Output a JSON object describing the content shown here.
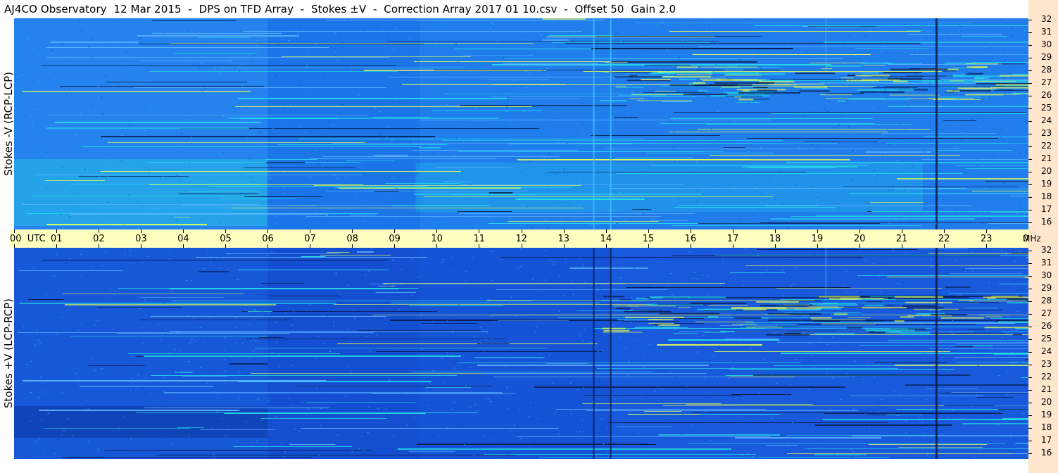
{
  "title": "AJ4CO Observatory  12 Mar 2015  -  DPS on TFD Array  -  Stokes ±V  -  Correction Array 2017 01 10.csv  -  Offset 50  Gain 2.0",
  "panels": {
    "top_label": "Stokes -V (RCP-LCP)",
    "bottom_label": "Stokes +V (LCP-RCP)"
  },
  "time_axis": {
    "labels": [
      "00  UTC",
      "01",
      "02",
      "03",
      "04",
      "05",
      "06",
      "07",
      "08",
      "09",
      "10",
      "11",
      "12",
      "13",
      "14",
      "15",
      "16",
      "17",
      "18",
      "19",
      "20",
      "21",
      "22",
      "23",
      "00"
    ],
    "background": "#ffffc0"
  },
  "freq_axis": {
    "unit": "MHz",
    "labels": [
      "32",
      "31",
      "30",
      "29",
      "28",
      "27",
      "26",
      "25",
      "24",
      "23",
      "22",
      "21",
      "20",
      "19",
      "18",
      "17",
      "16"
    ],
    "background": "#ffe6cc"
  },
  "colors": {
    "top_base": "#1e7bea",
    "bottom_base": "#1552d6",
    "hot": "#e8ff50",
    "cyan": "#25e0e6",
    "dark": "#071640"
  },
  "chart_data": {
    "type": "heatmap",
    "title": "AJ4CO Observatory  12 Mar 2015  -  DPS on TFD Array  -  Stokes ±V  -  Correction Array 2017 01 10.csv  -  Offset 50  Gain 2.0",
    "xlabel": "UTC",
    "ylabel": "MHz",
    "x_range": [
      0,
      24
    ],
    "y_range": [
      16,
      32
    ],
    "series": [
      {
        "name": "Stokes -V (RCP-LCP)"
      },
      {
        "name": "Stokes +V (LCP-RCP)"
      }
    ]
  }
}
